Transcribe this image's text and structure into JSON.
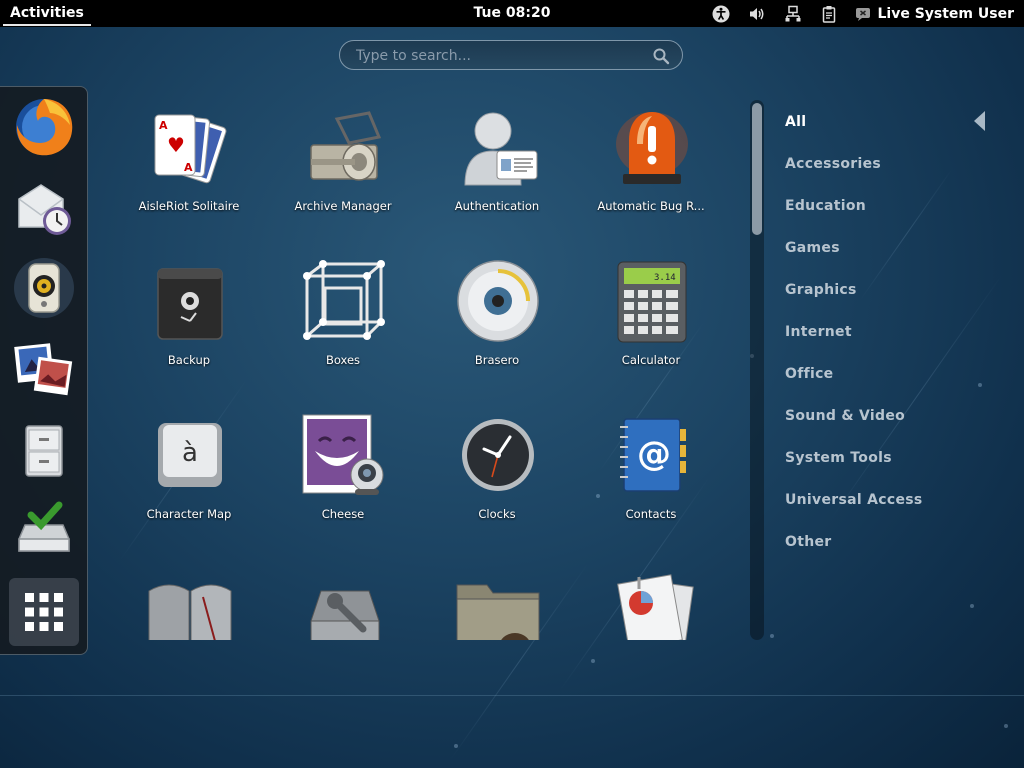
{
  "topbar": {
    "activities": "Activities",
    "clock": "Tue 08:20",
    "tray_icons": [
      "accessibility-icon",
      "volume-icon",
      "network-icon",
      "clipboard-icon"
    ],
    "user_name": "Live System User"
  },
  "search": {
    "placeholder": "Type to search..."
  },
  "dash": {
    "items": [
      "Firefox",
      "Evolution",
      "Rhythmbox",
      "Shotwell",
      "Files",
      "Install to Hard Drive"
    ],
    "show_apps_icon": "grid-icon"
  },
  "apps": [
    {
      "label": "AisleRiot Solitaire",
      "icon": "cards-icon"
    },
    {
      "label": "Archive Manager",
      "icon": "archive-roller-icon"
    },
    {
      "label": "Authentication",
      "icon": "person-id-icon"
    },
    {
      "label": "Automatic Bug R...",
      "icon": "alarm-light-icon"
    },
    {
      "label": "Backup",
      "icon": "safe-icon"
    },
    {
      "label": "Boxes",
      "icon": "wireframe-cube-icon"
    },
    {
      "label": "Brasero",
      "icon": "disc-icon"
    },
    {
      "label": "Calculator",
      "icon": "calculator-icon"
    },
    {
      "label": "Character Map",
      "icon": "keycap-icon"
    },
    {
      "label": "Cheese",
      "icon": "webcam-photo-icon"
    },
    {
      "label": "Clocks",
      "icon": "clock-icon"
    },
    {
      "label": "Contacts",
      "icon": "address-book-icon"
    },
    {
      "label": "",
      "icon": "book-icon"
    },
    {
      "label": "",
      "icon": "disk-utility-icon"
    },
    {
      "label": "",
      "icon": "folder-icon"
    },
    {
      "label": "",
      "icon": "document-viewer-icon"
    }
  ],
  "categories": [
    "All",
    "Accessories",
    "Education",
    "Games",
    "Graphics",
    "Internet",
    "Office",
    "Sound & Video",
    "System Tools",
    "Universal Access",
    "Other"
  ],
  "scroll_fraction": 0.25
}
